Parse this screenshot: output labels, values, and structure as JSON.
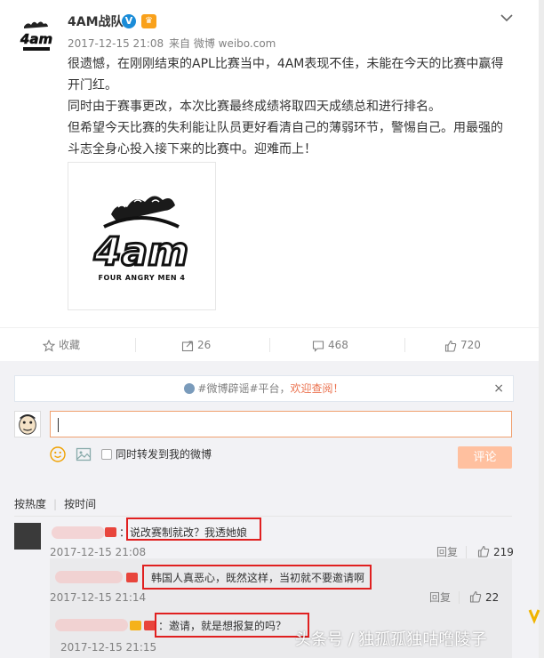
{
  "post": {
    "author": "4AM战队",
    "timestamp": "2017-12-15 21:08",
    "source_prefix": "来自",
    "source": "微博 weibo.com",
    "paragraphs": [
      "很遗憾，在刚刚结束的APL比赛当中，4AM表现不佳，未能在今天的比赛中赢得开门红。",
      "同时由于赛事更改，本次比赛最终成绩将取四天成绩总和进行排名。",
      "但希望今天比赛的失利能让队员更好看清自己的薄弱环节，警惕自己。用最强的斗志全身心投入接下来的比赛中。迎难而上！"
    ],
    "image_logo_text": "4am",
    "image_caption": "FOUR ANGRY MEN 4"
  },
  "actions": {
    "favorite_label": "收藏",
    "repost_count": "26",
    "comment_count": "468",
    "like_count": "720"
  },
  "notice": {
    "prefix": "#微博辟谣#平台，",
    "link": "欢迎查阅！",
    "close": "×"
  },
  "composer": {
    "repost_label": "同时转发到我的微博",
    "submit_label": "评论"
  },
  "sort": {
    "hot": "按热度",
    "time": "按时间"
  },
  "comments": [
    {
      "text": "：说改赛制就改？我透她娘",
      "time": "2017-12-15 21:08",
      "reply": "回复",
      "likes": "219"
    },
    {
      "text": "：韩国人真恶心，既然这样，当初就不要邀请啊",
      "time": "2017-12-15 21:14",
      "reply": "回复",
      "likes": "22"
    },
    {
      "text": "：邀请，就是想报复的吗？",
      "time": "2017-12-15 21:15"
    }
  ],
  "watermark": "头条号 / 独孤孤独咕噜陵子"
}
